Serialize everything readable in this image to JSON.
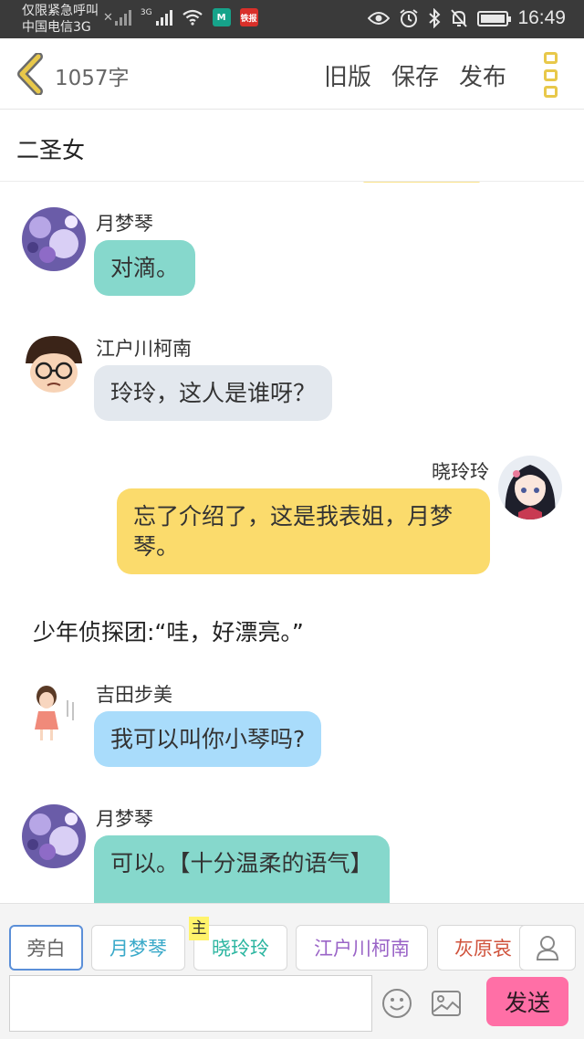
{
  "statusbar": {
    "carrier_line1": "仅限紧急呼叫",
    "carrier_line2": "中国电信3G",
    "network_label": "3G",
    "app_icon_1": "M",
    "app_icon_2": "铁报",
    "time": "16:49",
    "icons": [
      "no-signal-icon",
      "signal-icon",
      "wifi-icon",
      "eye-icon",
      "alarm-icon",
      "bluetooth-icon",
      "mute-icon",
      "battery-icon"
    ],
    "colors": {
      "app_icon_1": "#16a38a",
      "app_icon_2": "#d9302a"
    }
  },
  "topbar": {
    "back_icon": "chevron-left-icon",
    "word_count": "1057字",
    "old_version": "旧版",
    "save": "保存",
    "publish": "发布",
    "menu_icon": "menu-dots-icon",
    "accent": "#e8c84a"
  },
  "title": "二圣女",
  "messages": [
    {
      "kind": "left",
      "name": "月梦琴",
      "text": "对滴。",
      "bubble_color": "#86d8cc",
      "avatar": "purple-flowers-avatar"
    },
    {
      "kind": "left",
      "name": "江户川柯南",
      "text": "玲玲，这人是谁呀？",
      "bubble_color": "#e3e8ee",
      "avatar": "conan-avatar"
    },
    {
      "kind": "right",
      "name": "晓玲玲",
      "text": "忘了介绍了，这是我表姐，月梦琴。",
      "bubble_color": "#fbdb6c",
      "avatar": "anime-girl-avatar"
    },
    {
      "kind": "narration",
      "text": "少年侦探团:“哇，好漂亮。”"
    },
    {
      "kind": "left",
      "name": "吉田步美",
      "text": "我可以叫你小琴吗?",
      "bubble_color": "#a9dcfb",
      "avatar": "ayumi-avatar"
    },
    {
      "kind": "left",
      "name": "月梦琴",
      "text": "可以。【十分温柔的语气】",
      "bubble_color": "#86d8cc",
      "avatar": "purple-flowers-avatar"
    }
  ],
  "characters": [
    {
      "label": "旁白",
      "color": "#666666",
      "selected": true
    },
    {
      "label": "月梦琴",
      "color": "#3aa9c9",
      "selected": false
    },
    {
      "label": "晓玲玲",
      "color": "#2bb5a0",
      "selected": false,
      "main": true
    },
    {
      "label": "江户川柯南",
      "color": "#9a64c7",
      "selected": false
    },
    {
      "label": "灰原哀",
      "color": "#d0533c",
      "selected": false
    }
  ],
  "main_tag": "主",
  "composer": {
    "input_value": "",
    "emoji_icon": "smiley-icon",
    "image_icon": "image-icon",
    "user_icon": "user-icon",
    "send": "发送",
    "send_color": "#ff6fa6"
  }
}
